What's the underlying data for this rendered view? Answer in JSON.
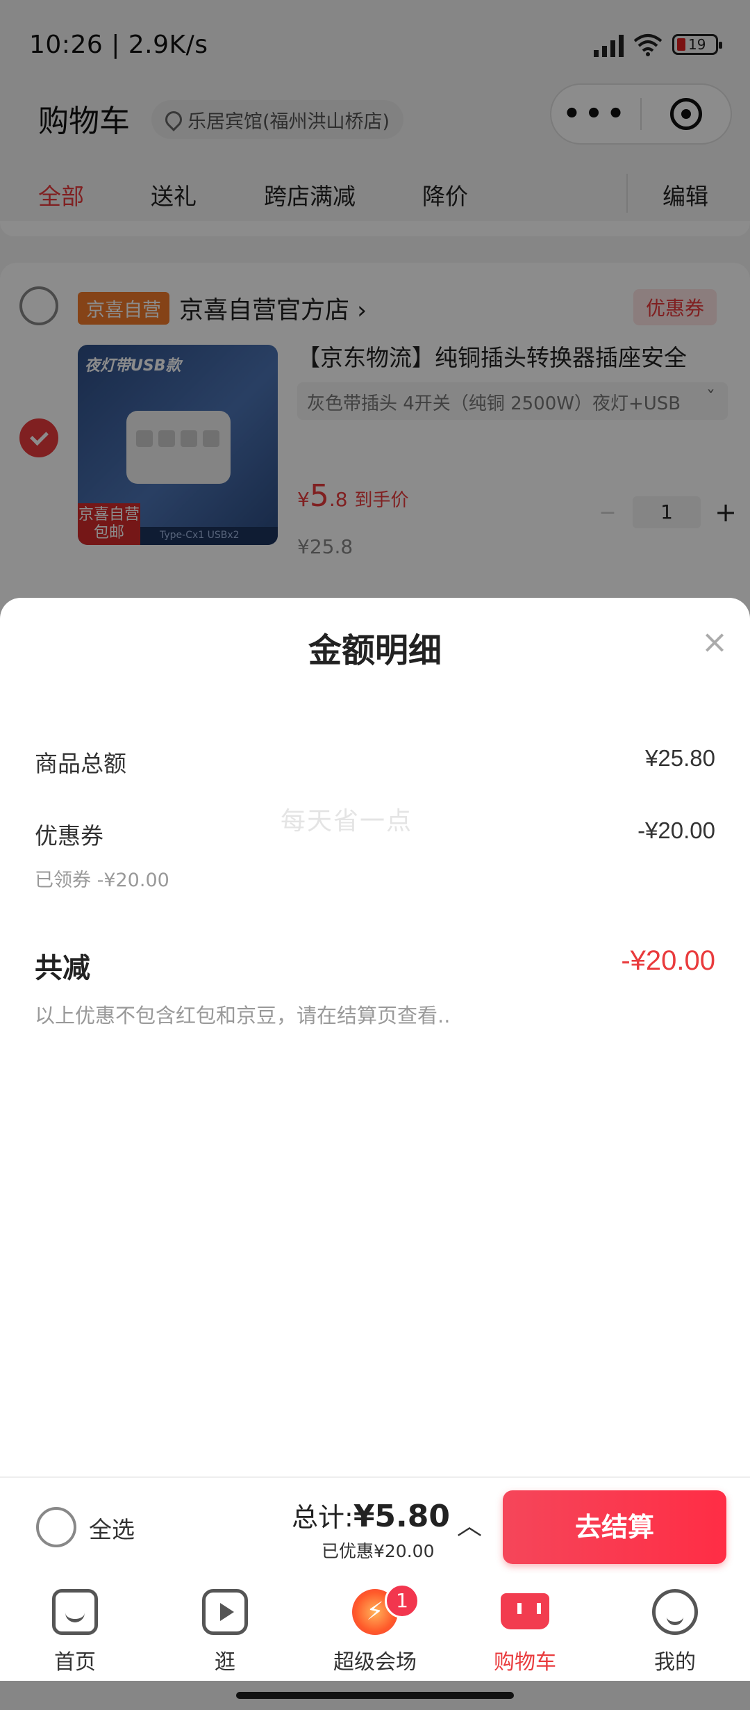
{
  "status_bar": {
    "time": "10:26 | 2.9K/s",
    "battery": "19"
  },
  "header": {
    "title": "购物车",
    "location": "乐居宾馆(福州洪山桥店)",
    "more_glyph": "•••"
  },
  "tabs": [
    {
      "label": "全部",
      "active": true
    },
    {
      "label": "送礼"
    },
    {
      "label": "跨店满减"
    },
    {
      "label": "降价"
    },
    {
      "label": "编辑"
    }
  ],
  "store": {
    "self_tag": "京喜自营",
    "name": "京喜自营官方店 ›",
    "coupon": "优惠券",
    "product": {
      "image_title": "夜灯带USB款",
      "image_ship_tag": "京喜自营 包邮",
      "image_strip": "Type-Cx1   USBx2",
      "title": "【京东物流】纯铜插头转换器插座安全",
      "spec": "灰色带插头 4开关（纯铜 2500W）夜灯+USB",
      "price_currency": "¥",
      "price_int": "5",
      "price_dec": ".8",
      "price_label": "到手价",
      "original_price": "¥25.8",
      "quantity": "1"
    }
  },
  "sheet": {
    "title": "金额明细",
    "close_glyph": "×",
    "goods_total_label": "商品总额",
    "goods_total_value": "¥25.80",
    "coupon_label": "优惠券",
    "coupon_value": "-¥20.00",
    "coupon_note": "已领券 -¥20.00",
    "watermark": "每天省一点",
    "total_discount_label": "共减",
    "total_discount_value": "-¥20.00",
    "total_note": "以上优惠不包含红包和京豆，请在结算页查看.."
  },
  "checkout": {
    "select_all": "全选",
    "total_prefix": "总计:",
    "total_value": "¥5.80",
    "discount": "已优惠¥20.00",
    "button": "去结算"
  },
  "bottom_nav": [
    {
      "label": "首页",
      "icon": "home-icon"
    },
    {
      "label": "逛",
      "icon": "play-icon"
    },
    {
      "label": "超级会场",
      "icon": "venue-icon",
      "badge": "1"
    },
    {
      "label": "购物车",
      "icon": "cart-icon",
      "active": true
    },
    {
      "label": "我的",
      "icon": "profile-icon"
    }
  ],
  "colors": {
    "accent": "#e93b3d",
    "tag_orange": "#f27b2b"
  }
}
